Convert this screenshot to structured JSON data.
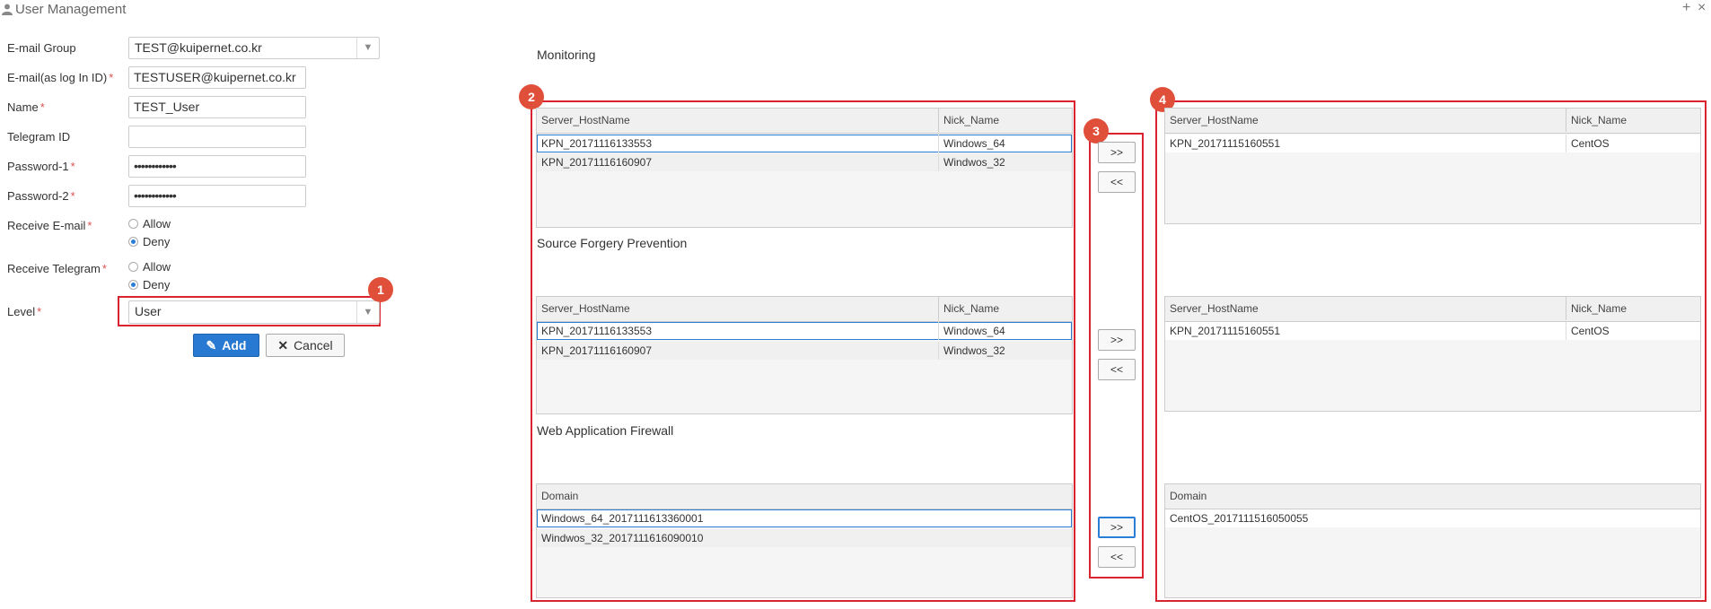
{
  "window": {
    "title": "User Management",
    "add_icon": "+",
    "close_icon": "×"
  },
  "form": {
    "email_group": {
      "label": "E-mail Group",
      "value": "TEST@kuipernet.co.kr"
    },
    "email": {
      "label": "E-mail(as log In ID)",
      "value": "TESTUSER@kuipernet.co.kr"
    },
    "name": {
      "label": "Name",
      "value": "TEST_User"
    },
    "telegram": {
      "label": "Telegram ID",
      "value": ""
    },
    "password1": {
      "label": "Password-1",
      "value": "••••••••••••"
    },
    "password2": {
      "label": "Password-2",
      "value": "••••••••••••"
    },
    "receive_email": {
      "label": "Receive E-mail",
      "options": [
        "Allow",
        "Deny"
      ],
      "selected": "Deny"
    },
    "receive_telegram": {
      "label": "Receive Telegram",
      "options": [
        "Allow",
        "Deny"
      ],
      "selected": "Deny"
    },
    "level": {
      "label": "Level",
      "value": "User"
    },
    "required_mark": "*",
    "add_label": "Add",
    "cancel_label": "Cancel"
  },
  "badges": [
    "1",
    "2",
    "3",
    "4"
  ],
  "move_right": ">>",
  "move_left": "<<",
  "sections": [
    {
      "title": "Monitoring",
      "left": {
        "columns": [
          "Server_HostName",
          "Nick_Name"
        ],
        "rows": [
          [
            "KPN_20171116133553",
            "Windows_64"
          ],
          [
            "KPN_20171116160907",
            "Windwos_32"
          ]
        ]
      },
      "right": {
        "columns": [
          "Server_HostName",
          "Nick_Name"
        ],
        "rows": [
          [
            "KPN_20171115160551",
            "CentOS"
          ]
        ]
      }
    },
    {
      "title": "Source Forgery Prevention",
      "left": {
        "columns": [
          "Server_HostName",
          "Nick_Name"
        ],
        "rows": [
          [
            "KPN_20171116133553",
            "Windows_64"
          ],
          [
            "KPN_20171116160907",
            "Windwos_32"
          ]
        ]
      },
      "right": {
        "columns": [
          "Server_HostName",
          "Nick_Name"
        ],
        "rows": [
          [
            "KPN_20171115160551",
            "CentOS"
          ]
        ]
      }
    },
    {
      "title": "Web Application Firewall",
      "left": {
        "columns": [
          "Domain"
        ],
        "rows": [
          [
            "Windows_64_2017111613360001"
          ],
          [
            "Windwos_32_2017111616090010"
          ]
        ]
      },
      "right": {
        "columns": [
          "Domain"
        ],
        "rows": [
          [
            "CentOS_2017111516050055"
          ]
        ]
      }
    }
  ],
  "colors": {
    "accent": "#2779d1",
    "highlight_box": "#d9232e",
    "badge": "#e04f39"
  }
}
